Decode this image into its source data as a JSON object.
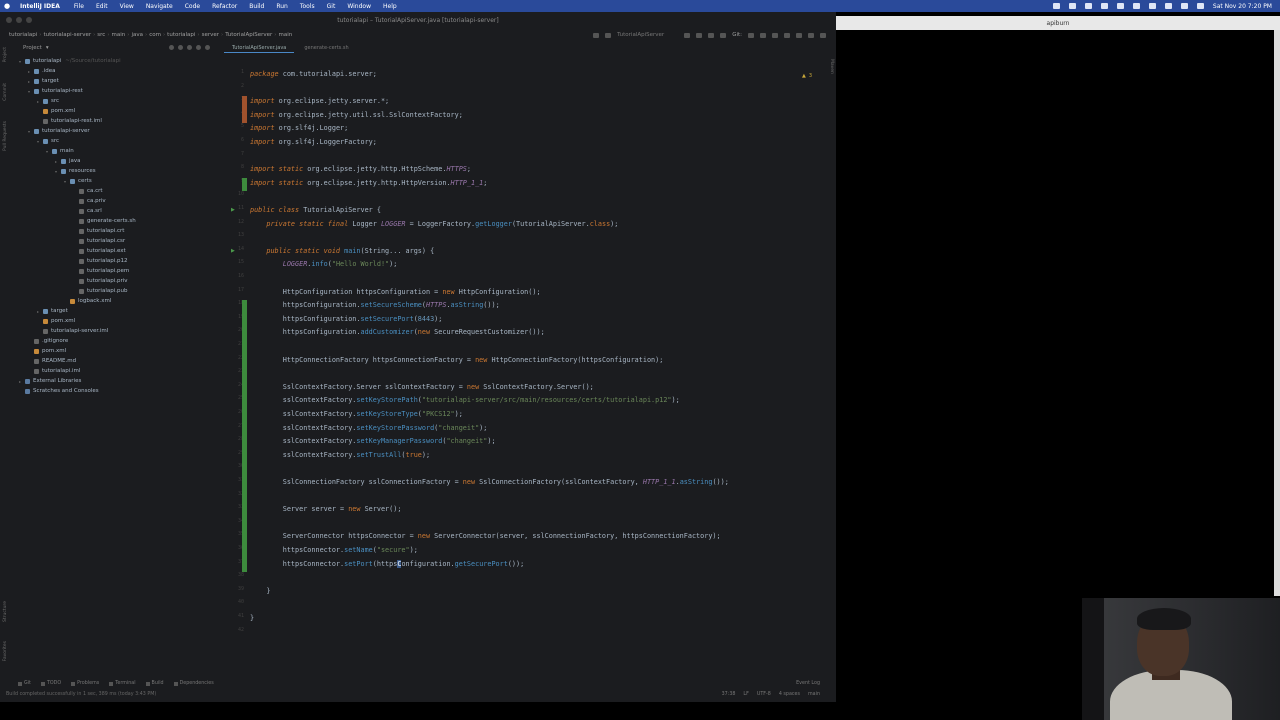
{
  "menubar": {
    "app_name": "IntelliJ IDEA",
    "items": [
      "File",
      "Edit",
      "View",
      "Navigate",
      "Code",
      "Refactor",
      "Build",
      "Run",
      "Tools",
      "Git",
      "Window",
      "Help"
    ],
    "datetime": "Sat Nov 20  7:20 PM"
  },
  "window": {
    "title": "tutorialapi – TutorialApiServer.java [tutorialapi-server]"
  },
  "navbar": {
    "crumbs": [
      "tutorialapi",
      "tutorialapi-server",
      "src",
      "main",
      "java",
      "com",
      "tutorialapi",
      "server",
      "TutorialApiServer",
      "main"
    ],
    "run_config": "TutorialApiServer",
    "vcs_label": "Git:"
  },
  "project": {
    "header": "Project",
    "nodes": [
      {
        "label": "tutorialapi",
        "hint": "~/Source/tutorialapi",
        "depth": 0,
        "icon": "folder-icon",
        "arrow": "▾",
        "type": "fold"
      },
      {
        "label": ".idea",
        "depth": 1,
        "icon": "folder-icon",
        "arrow": "▸",
        "type": "fold"
      },
      {
        "label": "target",
        "depth": 1,
        "icon": "folder-icon",
        "arrow": "▸",
        "type": "fold"
      },
      {
        "label": "tutorialapi-rest",
        "depth": 1,
        "icon": "folder-icon",
        "arrow": "▾",
        "type": "fold"
      },
      {
        "label": "src",
        "depth": 2,
        "icon": "folder-icon",
        "arrow": "▸",
        "type": "fold"
      },
      {
        "label": "pom.xml",
        "depth": 2,
        "icon": "xml-file-icon",
        "arrow": "",
        "type": "xml"
      },
      {
        "label": "tutorialapi-rest.iml",
        "depth": 2,
        "icon": "file-icon",
        "arrow": "",
        "type": "file"
      },
      {
        "label": "tutorialapi-server",
        "depth": 1,
        "icon": "folder-icon",
        "arrow": "▾",
        "type": "fold"
      },
      {
        "label": "src",
        "depth": 2,
        "icon": "folder-icon",
        "arrow": "▾",
        "type": "fold"
      },
      {
        "label": "main",
        "depth": 3,
        "icon": "folder-icon",
        "arrow": "▾",
        "type": "fold"
      },
      {
        "label": "java",
        "depth": 4,
        "icon": "folder-icon",
        "arrow": "▸",
        "type": "fold"
      },
      {
        "label": "resources",
        "depth": 4,
        "icon": "folder-icon",
        "arrow": "▾",
        "type": "fold"
      },
      {
        "label": "certs",
        "depth": 5,
        "icon": "folder-icon",
        "arrow": "▾",
        "type": "fold"
      },
      {
        "label": "ca.crt",
        "depth": 6,
        "icon": "file-icon",
        "arrow": "",
        "type": "file"
      },
      {
        "label": "ca.priv",
        "depth": 6,
        "icon": "file-icon",
        "arrow": "",
        "type": "file"
      },
      {
        "label": "ca.srl",
        "depth": 6,
        "icon": "file-icon",
        "arrow": "",
        "type": "file"
      },
      {
        "label": "generate-certs.sh",
        "depth": 6,
        "icon": "file-icon",
        "arrow": "",
        "type": "file"
      },
      {
        "label": "tutorialapi.crt",
        "depth": 6,
        "icon": "file-icon",
        "arrow": "",
        "type": "file"
      },
      {
        "label": "tutorialapi.csr",
        "depth": 6,
        "icon": "file-icon",
        "arrow": "",
        "type": "file"
      },
      {
        "label": "tutorialapi.ext",
        "depth": 6,
        "icon": "file-icon",
        "arrow": "",
        "type": "file"
      },
      {
        "label": "tutorialapi.p12",
        "depth": 6,
        "icon": "file-icon",
        "arrow": "",
        "type": "file"
      },
      {
        "label": "tutorialapi.pem",
        "depth": 6,
        "icon": "file-icon",
        "arrow": "",
        "type": "file"
      },
      {
        "label": "tutorialapi.priv",
        "depth": 6,
        "icon": "file-icon",
        "arrow": "",
        "type": "file"
      },
      {
        "label": "tutorialapi.pub",
        "depth": 6,
        "icon": "file-icon",
        "arrow": "",
        "type": "file"
      },
      {
        "label": "logback.xml",
        "depth": 5,
        "icon": "xml-file-icon",
        "arrow": "",
        "type": "xml"
      },
      {
        "label": "target",
        "depth": 2,
        "icon": "folder-icon",
        "arrow": "▸",
        "type": "fold"
      },
      {
        "label": "pom.xml",
        "depth": 2,
        "icon": "xml-file-icon",
        "arrow": "",
        "type": "xml"
      },
      {
        "label": "tutorialapi-server.iml",
        "depth": 2,
        "icon": "file-icon",
        "arrow": "",
        "type": "file"
      },
      {
        "label": ".gitignore",
        "depth": 1,
        "icon": "file-icon",
        "arrow": "",
        "type": "file"
      },
      {
        "label": "pom.xml",
        "depth": 1,
        "icon": "xml-file-icon",
        "arrow": "",
        "type": "xml"
      },
      {
        "label": "README.md",
        "depth": 1,
        "icon": "file-icon",
        "arrow": "",
        "type": "file"
      },
      {
        "label": "tutorialapi.iml",
        "depth": 1,
        "icon": "file-icon",
        "arrow": "",
        "type": "file"
      },
      {
        "label": "External Libraries",
        "depth": 0,
        "icon": "library-icon",
        "arrow": "▸",
        "type": "lib"
      },
      {
        "label": "Scratches and Consoles",
        "depth": 0,
        "icon": "library-icon",
        "arrow": "",
        "type": "lib"
      }
    ]
  },
  "editor": {
    "tabs": [
      "TutorialApiServer.java",
      "generate-certs.sh"
    ],
    "active_tab": 0,
    "lines": [
      [
        [
          "package ",
          "kw"
        ],
        [
          "com.tutorialapi.server;",
          "pl"
        ]
      ],
      [],
      [
        [
          "import ",
          "kw"
        ],
        [
          "org.eclipse.jetty.server.*;",
          "pl"
        ]
      ],
      [
        [
          "import ",
          "kw"
        ],
        [
          "org.eclipse.jetty.util.ssl.SslContextFactory;",
          "pl"
        ]
      ],
      [
        [
          "import ",
          "kw"
        ],
        [
          "org.slf4j.Logger;",
          "pl"
        ]
      ],
      [
        [
          "import ",
          "kw"
        ],
        [
          "org.slf4j.LoggerFactory;",
          "pl"
        ]
      ],
      [],
      [
        [
          "import static ",
          "kw"
        ],
        [
          "org.eclipse.jetty.http.HttpScheme.",
          "pl"
        ],
        [
          "HTTPS",
          "fii"
        ],
        [
          ";",
          "pl"
        ]
      ],
      [
        [
          "import static ",
          "kw"
        ],
        [
          "org.eclipse.jetty.http.HttpVersion.",
          "pl"
        ],
        [
          "HTTP_1_1",
          "fii"
        ],
        [
          ";",
          "pl"
        ]
      ],
      [],
      [
        [
          "public class ",
          "kw"
        ],
        [
          "TutorialApiServer {",
          "pl"
        ]
      ],
      [
        [
          "    private static final ",
          "kw"
        ],
        [
          "Logger ",
          "pl"
        ],
        [
          "LOGGER",
          "fii"
        ],
        [
          " = LoggerFactory.",
          "pl"
        ],
        [
          "getLogger",
          "me"
        ],
        [
          "(TutorialApiServer.",
          "pl"
        ],
        [
          "class",
          "kwn"
        ],
        [
          ");",
          "pl"
        ]
      ],
      [],
      [
        [
          "    public static void ",
          "kw"
        ],
        [
          "main",
          "me"
        ],
        [
          "(String... args) {",
          "pl"
        ]
      ],
      [
        [
          "        LOGGER",
          "fii"
        ],
        [
          ".",
          "pl"
        ],
        [
          "info",
          "me"
        ],
        [
          "(",
          "pl"
        ],
        [
          "\"Hello World!\"",
          "st"
        ],
        [
          ");",
          "pl"
        ]
      ],
      [],
      [
        [
          "        HttpConfiguration httpsConfiguration = ",
          "pl"
        ],
        [
          "new ",
          "kwn"
        ],
        [
          "HttpConfiguration();",
          "pl"
        ]
      ],
      [
        [
          "        httpsConfiguration.",
          "pl"
        ],
        [
          "setSecureScheme",
          "me"
        ],
        [
          "(",
          "pl"
        ],
        [
          "HTTPS",
          "fii"
        ],
        [
          ".",
          "pl"
        ],
        [
          "asString",
          "me"
        ],
        [
          "());",
          "pl"
        ]
      ],
      [
        [
          "        httpsConfiguration.",
          "pl"
        ],
        [
          "setSecurePort",
          "me"
        ],
        [
          "(",
          "pl"
        ],
        [
          "8443",
          "nu"
        ],
        [
          ");",
          "pl"
        ]
      ],
      [
        [
          "        httpsConfiguration.",
          "pl"
        ],
        [
          "addCustomizer",
          "me"
        ],
        [
          "(",
          "pl"
        ],
        [
          "new ",
          "kwn"
        ],
        [
          "SecureRequestCustomizer());",
          "pl"
        ]
      ],
      [],
      [
        [
          "        HttpConnectionFactory httpsConnectionFactory = ",
          "pl"
        ],
        [
          "new ",
          "kwn"
        ],
        [
          "HttpConnectionFactory(httpsConfiguration);",
          "pl"
        ]
      ],
      [],
      [
        [
          "        SslContextFactory.Server sslContextFactory = ",
          "pl"
        ],
        [
          "new ",
          "kwn"
        ],
        [
          "SslContextFactory.Server();",
          "pl"
        ]
      ],
      [
        [
          "        sslContextFactory.",
          "pl"
        ],
        [
          "setKeyStorePath",
          "me"
        ],
        [
          "(",
          "pl"
        ],
        [
          "\"tutorialapi-server/src/main/resources/certs/tutorialapi.p12\"",
          "st"
        ],
        [
          ");",
          "pl"
        ]
      ],
      [
        [
          "        sslContextFactory.",
          "pl"
        ],
        [
          "setKeyStoreType",
          "me"
        ],
        [
          "(",
          "pl"
        ],
        [
          "\"PKCS12\"",
          "st"
        ],
        [
          ");",
          "pl"
        ]
      ],
      [
        [
          "        sslContextFactory.",
          "pl"
        ],
        [
          "setKeyStorePassword",
          "me"
        ],
        [
          "(",
          "pl"
        ],
        [
          "\"changeit\"",
          "st"
        ],
        [
          ");",
          "pl"
        ]
      ],
      [
        [
          "        sslContextFactory.",
          "pl"
        ],
        [
          "setKeyManagerPassword",
          "me"
        ],
        [
          "(",
          "pl"
        ],
        [
          "\"changeit\"",
          "st"
        ],
        [
          ");",
          "pl"
        ]
      ],
      [
        [
          "        sslContextFactory.",
          "pl"
        ],
        [
          "setTrustAll",
          "me"
        ],
        [
          "(",
          "pl"
        ],
        [
          "true",
          "kwn"
        ],
        [
          ");",
          "pl"
        ]
      ],
      [],
      [
        [
          "        SslConnectionFactory sslConnectionFactory = ",
          "pl"
        ],
        [
          "new ",
          "kwn"
        ],
        [
          "SslConnectionFactory(sslContextFactory, ",
          "pl"
        ],
        [
          "HTTP_1_1",
          "fii"
        ],
        [
          ".",
          "pl"
        ],
        [
          "asString",
          "me"
        ],
        [
          "());",
          "pl"
        ]
      ],
      [],
      [
        [
          "        Server server = ",
          "pl"
        ],
        [
          "new ",
          "kwn"
        ],
        [
          "Server();",
          "pl"
        ]
      ],
      [],
      [
        [
          "        ServerConnector httpsConnector = ",
          "pl"
        ],
        [
          "new ",
          "kwn"
        ],
        [
          "ServerConnector(server, sslConnectionFactory, httpsConnectionFactory);",
          "pl"
        ]
      ],
      [
        [
          "        httpsConnector.",
          "pl"
        ],
        [
          "setName",
          "me"
        ],
        [
          "(",
          "pl"
        ],
        [
          "\"secure\"",
          "st"
        ],
        [
          ");",
          "pl"
        ]
      ],
      [
        [
          "        httpsConnector.",
          "pl"
        ],
        [
          "setPort",
          "me"
        ],
        [
          "(https",
          "pl"
        ],
        [
          "C",
          "cr"
        ],
        [
          "onfiguration.",
          "pl"
        ],
        [
          "getSecurePort",
          "me"
        ],
        [
          "());",
          "pl"
        ]
      ],
      [],
      [
        [
          "    }",
          "pl"
        ]
      ],
      [],
      [
        [
          "}",
          "pl"
        ]
      ],
      []
    ],
    "change_markers": [
      {
        "from": 3,
        "to": 4,
        "color": "#a0522d"
      },
      {
        "from": 9,
        "to": 9,
        "color": "#3d8b3d"
      },
      {
        "from": 18,
        "to": 37,
        "color": "#3d8b3d"
      }
    ],
    "run_marker_lines": [
      11,
      14
    ],
    "inspections_count": "3"
  },
  "toolwindows": {
    "left": [
      "Project",
      "Commit",
      "Pull Requests"
    ],
    "left_bottom": [
      "Structure",
      "Favorites"
    ],
    "right": [
      "Maven"
    ]
  },
  "statusbar": {
    "buttons": [
      "Git",
      "TODO",
      "Problems",
      "Terminal",
      "Build",
      "Dependencies"
    ],
    "event_log": "Event Log",
    "message": "Build completed successfully in 1 sec, 389 ms (today 3:43 PM)",
    "position": "37:38",
    "line_sep": "LF",
    "encoding": "UTF-8",
    "indent": "4 spaces",
    "branch": "main"
  },
  "secondary_window": {
    "title": "apiburn"
  },
  "colors": {
    "menubar": "#2a4a9a",
    "editor_bg": "#1b1c1f",
    "keyword": "#cc7832",
    "string": "#6a8759",
    "number": "#6897bb",
    "method": "#4a8fc1",
    "field": "#9876aa",
    "added_marker": "#3d8b3d"
  }
}
